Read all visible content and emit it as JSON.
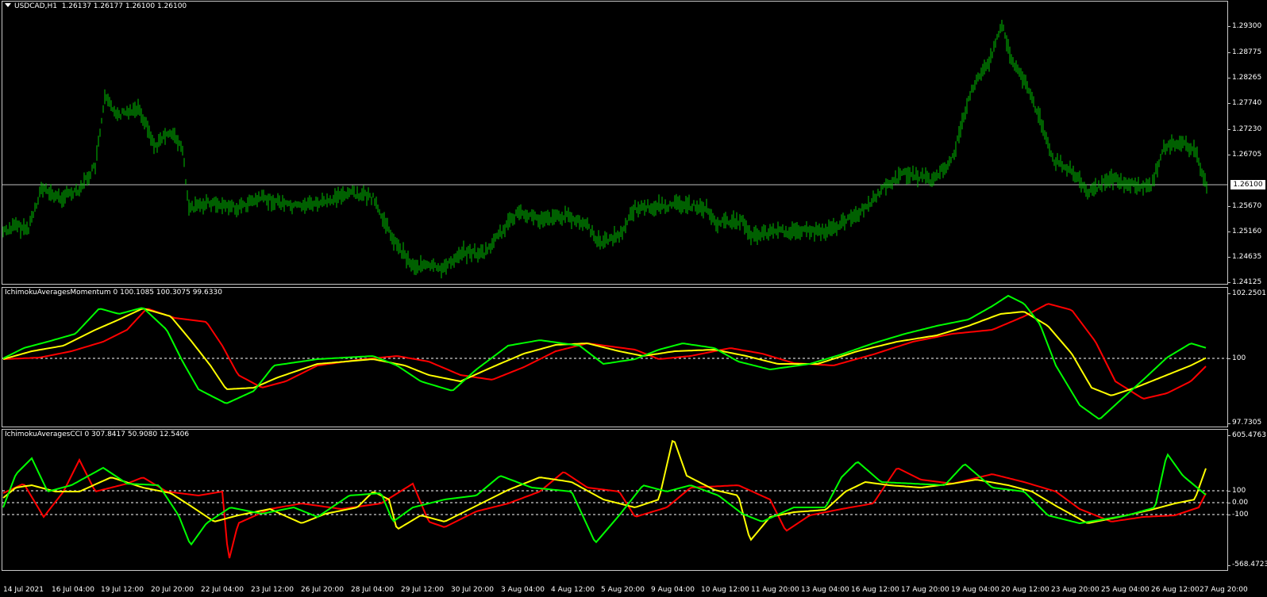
{
  "main": {
    "symbol_label": "USDCAD,H1",
    "ohlc": "1.26137 1.26177 1.26100 1.26100",
    "current_price": "1.26100",
    "y_labels": [
      "1.29300",
      "1.28775",
      "1.28265",
      "1.27740",
      "1.27230",
      "1.26705",
      "1.25670",
      "1.25160",
      "1.24635",
      "1.24125"
    ],
    "color_bars": "#00c000"
  },
  "momentum": {
    "label": "IchimokuAveragesMomentum 0 100.1085 100.3075 99.6330",
    "y_top": "102.2501",
    "y_mid": "100",
    "y_bottom": "97.7305"
  },
  "cci": {
    "label": "IchimokuAveragesCCI 0 307.8417 50.9080 12.5406",
    "y_top": "605.4763",
    "y_100": "100",
    "y_0": "0.00",
    "y_m100": "-100",
    "y_bottom": "-568.4723"
  },
  "x_labels": [
    "14 Jul 2021",
    "16 Jul 04:00",
    "19 Jul 12:00",
    "20 Jul 20:00",
    "22 Jul 04:00",
    "23 Jul 12:00",
    "26 Jul 20:00",
    "28 Jul 04:00",
    "29 Jul 12:00",
    "30 Jul 20:00",
    "3 Aug 04:00",
    "4 Aug 12:00",
    "5 Aug 20:00",
    "9 Aug 04:00",
    "10 Aug 12:00",
    "11 Aug 20:00",
    "13 Aug 04:00",
    "16 Aug 12:00",
    "17 Aug 20:00",
    "19 Aug 04:00",
    "20 Aug 12:00",
    "23 Aug 20:00",
    "25 Aug 04:00",
    "26 Aug 12:00",
    "27 Aug 20:00"
  ],
  "colors": {
    "green": "#00ff00",
    "yellow": "#ffff00",
    "red": "#ff0000"
  }
}
